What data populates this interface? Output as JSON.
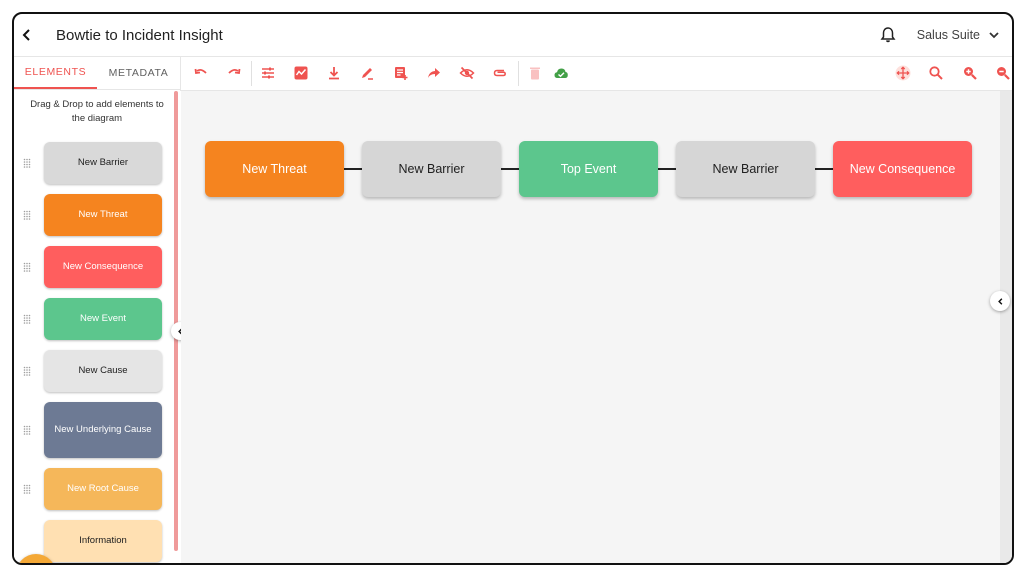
{
  "header": {
    "title": "Bowtie to Incident Insight",
    "org_name": "Salus Suite"
  },
  "left_panel": {
    "tabs": [
      {
        "label": "ELEMENTS",
        "active": true
      },
      {
        "label": "METADATA",
        "active": false
      }
    ],
    "hint": "Drag & Drop to add elements to the diagram",
    "palette": [
      {
        "label": "New Barrier",
        "bg": "#d9d9d9",
        "fg": "#212121"
      },
      {
        "label": "New Threat",
        "bg": "#f5841f",
        "fg": "#ffffff"
      },
      {
        "label": "New Consequence",
        "bg": "#ff5e5e",
        "fg": "#ffffff"
      },
      {
        "label": "New Event",
        "bg": "#5cc68d",
        "fg": "#ffffff"
      },
      {
        "label": "New Cause",
        "bg": "#e5e5e5",
        "fg": "#212121"
      },
      {
        "label": "New Underlying Cause",
        "bg": "#6d7a94",
        "fg": "#ffffff"
      },
      {
        "label": "New Root Cause",
        "bg": "#f5b75a",
        "fg": "#ffffff"
      },
      {
        "label": "Information",
        "bg": "#ffe0b2",
        "fg": "#212121"
      }
    ]
  },
  "toolbar": {
    "icons": [
      "undo-icon",
      "redo-icon",
      "tune-icon",
      "insights-icon",
      "download-icon",
      "edit-pen-icon",
      "note-add-icon",
      "share-arrow-icon",
      "visibility-off-icon",
      "attachment-icon",
      "delete-icon",
      "cloud-done-icon",
      "move-icon",
      "search-icon",
      "zoom-in-icon",
      "zoom-out-icon"
    ],
    "accent": "#ef5350",
    "cloud_color": "#43a047"
  },
  "diagram": {
    "nodes": [
      {
        "label": "New Threat",
        "bg": "#f5841f",
        "fg": "#ffffff"
      },
      {
        "label": "New Barrier",
        "bg": "#d6d6d6",
        "fg": "#212121"
      },
      {
        "label": "Top Event",
        "bg": "#5cc68d",
        "fg": "#ffffff"
      },
      {
        "label": "New Barrier",
        "bg": "#d6d6d6",
        "fg": "#212121"
      },
      {
        "label": "New Consequence",
        "bg": "#ff5e5e",
        "fg": "#ffffff"
      }
    ]
  }
}
